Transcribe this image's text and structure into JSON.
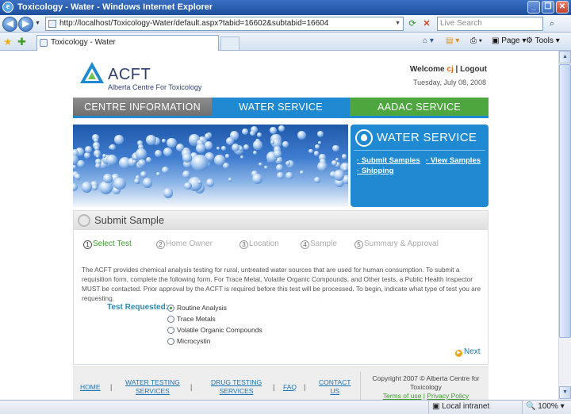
{
  "browser": {
    "title": "Toxicology - Water - Windows Internet Explorer",
    "url": "http://localhost/Toxicology-Water/default.aspx?tabid=16602&subtabid=16604",
    "search_placeholder": "Live Search",
    "tab_label": "Toxicology - Water",
    "page_menu": "Page",
    "tools_menu": "Tools",
    "status_zone": "Local intranet",
    "zoom": "100%"
  },
  "logo": {
    "name": "ACFT",
    "subtitle": "Alberta Centre For Toxicology"
  },
  "user": {
    "welcome_prefix": "Welcome",
    "username": "cj",
    "logout": "Logout",
    "date": "Tuesday, July 08, 2008"
  },
  "nav": {
    "centre": "CENTRE INFORMATION",
    "water": "WATER SERVICE",
    "aadac": "AADAC SERVICE"
  },
  "water_panel": {
    "title": "WATER SERVICE",
    "submit_samples": "Submit Samples",
    "view_samples": "View Samples",
    "shipping": "Shipping"
  },
  "form": {
    "title": "Submit Sample",
    "steps": [
      {
        "num": "1",
        "label": "Select Test"
      },
      {
        "num": "2",
        "label": "Home Owner"
      },
      {
        "num": "3",
        "label": "Location"
      },
      {
        "num": "4",
        "label": "Sample"
      },
      {
        "num": "5",
        "label": "Summary & Approval"
      }
    ],
    "intro": "The ACFT provides chemical analysis testing for rural, untreated water sources that are used for human consumption. To submit a requisition form, complete the following form. For Trace Metal, Volatile Organic Compounds, and Other tests, a Public Health Inspector MUST be contacted. Prior approval by the ACFT is required before this test will be processed. To begin, indicate what type of test you are requesting.",
    "test_label": "Test Requested:",
    "options": [
      "Routine Analysis",
      "Trace Metals",
      "Volatile Organic Compounds",
      "Microcystin"
    ],
    "selected_option": "Routine Analysis",
    "next": "Next"
  },
  "footer": {
    "home": "HOME",
    "water_testing_1": "WATER TESTING",
    "water_testing_2": "SERVICES",
    "drug_testing_1": "DRUG TESTING",
    "drug_testing_2": "SERVICES",
    "faq": "FAQ",
    "contact_1": "CONTACT",
    "contact_2": "US",
    "separator": "|",
    "copyright_1": "Copyright 2007 © Alberta Centre for",
    "copyright_2": "Toxicology",
    "terms": "Terms of use",
    "privacy": "Privacy Policy"
  },
  "colors": {
    "nav_grey": "#7f7f7f",
    "water_blue": "#1f8ad2",
    "aadac_green": "#4ea63f",
    "active_step_green": "#3f9a2f"
  }
}
